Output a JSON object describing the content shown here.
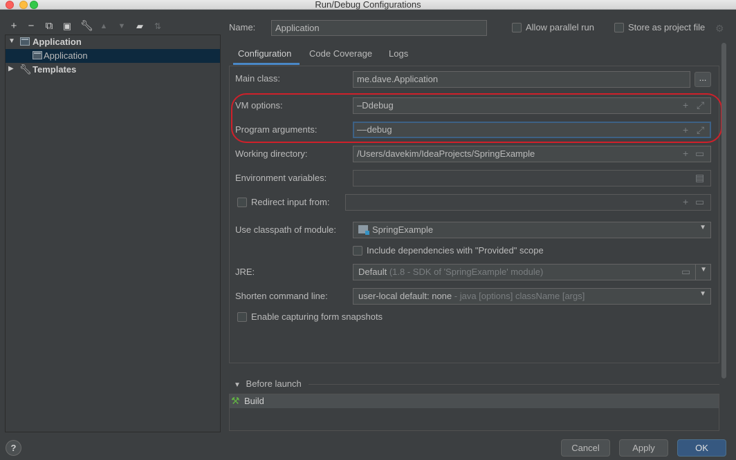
{
  "window": {
    "title": "Run/Debug Configurations"
  },
  "left_toolbar": {
    "icons": [
      "add-icon",
      "remove-icon",
      "copy-icon",
      "save-icon",
      "wrench-icon",
      "move-up-icon",
      "move-down-icon",
      "new-folder-icon",
      "sort-icon"
    ]
  },
  "tree": {
    "items": [
      {
        "label": "Application",
        "expanded": true
      },
      {
        "label": "Application",
        "selected": true
      },
      {
        "label": "Templates",
        "expanded": false
      }
    ]
  },
  "header": {
    "name_label": "Name:",
    "name_value": "Application",
    "allow_parallel_label": "Allow parallel run",
    "store_project_label": "Store as project file"
  },
  "tabs": [
    {
      "label": "Configuration",
      "active": true
    },
    {
      "label": "Code Coverage"
    },
    {
      "label": "Logs"
    }
  ],
  "form": {
    "main_class_label": "Main class:",
    "main_class_value": "me.dave.Application",
    "vm_options_label": "VM options:",
    "vm_options_value": "–Ddebug",
    "program_args_label": "Program arguments:",
    "program_args_value": "––debug",
    "working_dir_label": "Working directory:",
    "working_dir_value": "/Users/davekim/IdeaProjects/SpringExample",
    "env_vars_label": "Environment variables:",
    "env_vars_value": "",
    "redirect_label": "Redirect input from:",
    "redirect_value": "",
    "classpath_label": "Use classpath of module:",
    "classpath_value": "SpringExample",
    "include_deps_label": "Include dependencies with \"Provided\" scope",
    "jre_label": "JRE:",
    "jre_value": "Default",
    "jre_hint": "(1.8 - SDK of 'SpringExample' module)",
    "shorten_label": "Shorten command line:",
    "shorten_value": "user-local default: none",
    "shorten_hint": "- java [options] className [args]",
    "snapshots_label": "Enable capturing form snapshots",
    "ellipsis": "..."
  },
  "before_launch": {
    "label": "Before launch",
    "items": [
      "Build"
    ]
  },
  "footer": {
    "help": "?",
    "cancel": "Cancel",
    "apply": "Apply",
    "ok": "OK"
  },
  "colors": {
    "accent": "#4a88c7",
    "primary_button": "#365880",
    "highlight_ring": "#d0202a",
    "selection": "#0d293e"
  }
}
